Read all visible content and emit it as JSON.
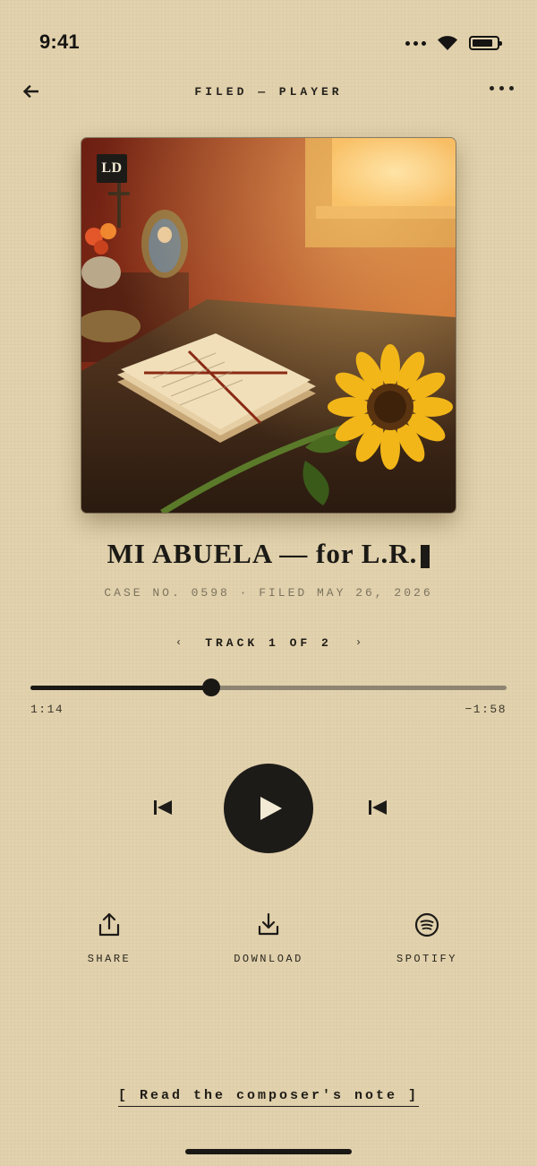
{
  "status_bar": {
    "time": "9:41"
  },
  "nav": {
    "title": "FILED — PLAYER"
  },
  "artwork": {
    "badge": "LD"
  },
  "track": {
    "title": "MI ABUELA — for L.R.",
    "case_line": "CASE NO. 0598 · FILED MAY 26, 2026",
    "position_label": "TRACK 1 OF 2",
    "prev_symbol": "‹",
    "next_symbol": "›"
  },
  "playback": {
    "elapsed": "1:14",
    "remaining": "−1:58",
    "progress_fraction": 0.38
  },
  "controls": {
    "prev_icon": "skip-back-icon",
    "play_icon": "play-icon",
    "next_icon": "skip-back-icon"
  },
  "actions": [
    {
      "label": "SHARE",
      "icon": "share-icon"
    },
    {
      "label": "DOWNLOAD",
      "icon": "download-icon"
    },
    {
      "label": "SPOTIFY",
      "icon": "spotify-icon"
    }
  ],
  "footer": {
    "note_link": "[ Read the composer's note ]"
  },
  "colors": {
    "background": "#e2d2ad",
    "ink": "#1d1b18",
    "muted": "#7c735f"
  }
}
